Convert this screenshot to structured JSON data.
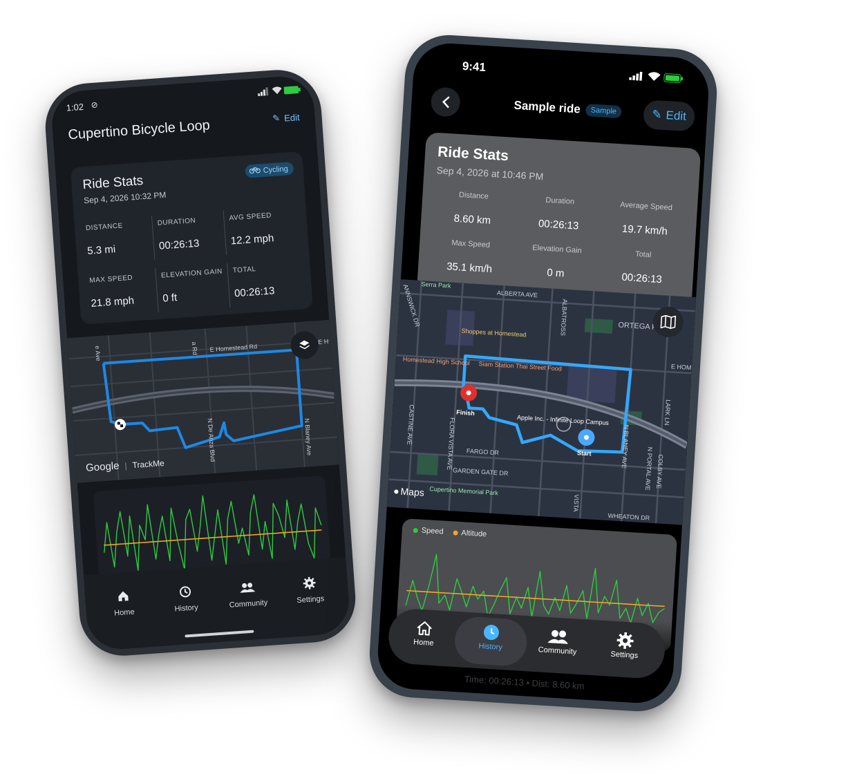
{
  "phone_left": {
    "status": {
      "time": "1:02"
    },
    "title": "Cupertino Bicycle Loop",
    "edit_label": "Edit",
    "card": {
      "title": "Ride Stats",
      "date": "Sep 4, 2026 10:32 PM",
      "badge": "Cycling",
      "stats": [
        {
          "label": "DISTANCE",
          "value": "5.3 mi"
        },
        {
          "label": "DURATION",
          "value": "00:26:13"
        },
        {
          "label": "AVG SPEED",
          "value": "12.2 mph"
        },
        {
          "label": "MAX SPEED",
          "value": "21.8 mph"
        },
        {
          "label": "ELEVATION GAIN",
          "value": "0 ft"
        },
        {
          "label": "TOTAL",
          "value": "00:26:13"
        }
      ]
    },
    "map": {
      "attribution_logo": "Google",
      "attribution_text": "TrackMe",
      "streets": [
        "E Homestead Rd",
        "a Rd",
        "N De Anza Blvd",
        "N Blaney Ave",
        "e Ave",
        "E H"
      ],
      "route_color": "#1e88e5"
    },
    "nav": [
      {
        "label": "Home",
        "icon": "home-icon"
      },
      {
        "label": "History",
        "icon": "history-icon"
      },
      {
        "label": "Community",
        "icon": "community-icon"
      },
      {
        "label": "Settings",
        "icon": "settings-icon"
      }
    ]
  },
  "phone_right": {
    "status": {
      "time": "9:41"
    },
    "title": "Sample ride",
    "badge": "Sample",
    "edit_label": "Edit",
    "card": {
      "title": "Ride Stats",
      "date": "Sep 4, 2026 at 10:46 PM",
      "stats": [
        {
          "label": "Distance",
          "value": "8.60 km"
        },
        {
          "label": "Duration",
          "value": "00:26:13"
        },
        {
          "label": "Average Speed",
          "value": "19.7 km/h"
        },
        {
          "label": "Max Speed",
          "value": "35.1 km/h"
        },
        {
          "label": "Elevation Gain",
          "value": "0 m"
        },
        {
          "label": "Total",
          "value": "00:26:13"
        }
      ]
    },
    "map": {
      "logo": "Maps",
      "places": [
        "Serra Park",
        "Shoppes at Homestead",
        "Homestead High School",
        "Siam Station Thai Street Food",
        "Apple Inc. - Infinite Loop Campus",
        "Cupertino Memorial Park"
      ],
      "streets": [
        "ALBERTA AVE",
        "ALBATROSS",
        "ORTEGA PAR",
        "E HOMI",
        "LARK LN",
        "FLORA VISTA AVE",
        "FARGO DR",
        "GARDEN GATE DR",
        "N BLANEY AVE",
        "N PORTAL AVE",
        "COLBY AVE",
        "CASTINE AVE",
        "WHEATON DR",
        "VISTA",
        "ANNSWICK DR"
      ],
      "markers": {
        "finish": "Finish",
        "start": "Start"
      },
      "route_color": "#34a8ff"
    },
    "chart_legend": [
      {
        "name": "Speed",
        "color": "#2ecc40"
      },
      {
        "name": "Altitude",
        "color": "#f5a623"
      }
    ],
    "tabbar": [
      {
        "label": "Home",
        "icon": "home-icon"
      },
      {
        "label": "History",
        "icon": "history-icon",
        "active": true
      },
      {
        "label": "Community",
        "icon": "community-icon"
      },
      {
        "label": "Settings",
        "icon": "settings-icon"
      }
    ],
    "footer_text": "Time: 00:26:13 • Dist: 8.60 km"
  },
  "chart_data": [
    {
      "type": "line",
      "series": [
        {
          "color": "#2ecc40",
          "values": [
            14,
            26,
            8,
            22,
            30,
            12,
            28,
            6,
            24,
            18,
            32,
            10,
            20,
            27,
            9,
            30,
            16,
            5,
            25,
            29,
            12,
            22,
            34,
            8,
            18,
            28,
            6,
            24,
            31,
            14,
            20,
            9,
            26,
            33,
            11,
            22,
            7,
            29,
            24,
            15,
            30,
            10,
            21,
            28,
            12,
            6,
            26,
            19
          ]
        },
        {
          "color": "#f5a623",
          "values": [
            17,
            17,
            17,
            17,
            17,
            17,
            17,
            17,
            17,
            17,
            17,
            17,
            17,
            17,
            17,
            17,
            17,
            17,
            17,
            17,
            17,
            17,
            17,
            17,
            17,
            17,
            17,
            17,
            17,
            17,
            17,
            17,
            17,
            17,
            17,
            17,
            17,
            17,
            17,
            17,
            17,
            17,
            17,
            17,
            17,
            17,
            17,
            17
          ]
        }
      ],
      "ylim": [
        0,
        36
      ]
    },
    {
      "type": "line",
      "series": [
        {
          "name": "Speed",
          "color": "#2ecc40",
          "values": [
            10,
            22,
            14,
            8,
            20,
            35,
            12,
            16,
            9,
            24,
            18,
            11,
            21,
            15,
            19,
            7,
            13,
            20,
            26,
            9,
            17,
            12,
            22,
            8,
            30,
            14,
            10,
            18,
            12,
            24,
            11,
            16,
            22,
            9,
            33,
            12,
            20,
            16,
            28,
            10,
            15,
            8,
            20,
            12,
            18,
            9,
            14,
            16
          ]
        },
        {
          "name": "Altitude",
          "color": "#f5a623",
          "values": [
            17,
            17,
            17,
            17,
            17,
            17,
            17,
            17,
            17,
            17,
            17,
            17,
            17,
            17,
            17,
            17,
            17,
            17,
            17,
            17,
            17,
            17,
            17,
            17,
            17,
            17,
            17,
            17,
            17,
            17,
            17,
            17,
            17,
            17,
            17,
            17,
            17,
            17,
            17,
            17,
            17,
            17,
            17,
            17,
            17,
            17,
            17,
            17
          ]
        }
      ],
      "ylim": [
        0,
        38
      ]
    }
  ]
}
